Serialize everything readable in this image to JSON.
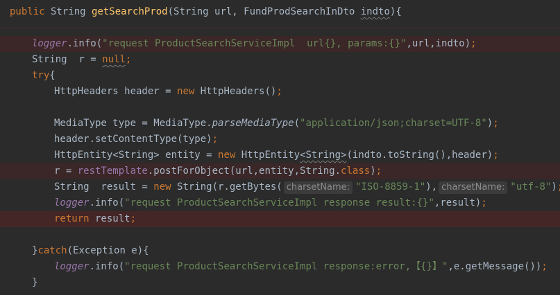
{
  "code": {
    "line1": {
      "kw_public": "public",
      "type_string": " String ",
      "method_name": "getSearchProd",
      "params_open": "(String url, FundProdSearchInDto ",
      "param_indto": "indto",
      "params_close": "){"
    },
    "line3": {
      "logger": "logger",
      "call": ".info(",
      "str": "\"request ProductSearchServiceImpl  url{}, params:{}\"",
      "args": ",url,indto)",
      "semi": ";"
    },
    "line4": {
      "decl": "String  r = ",
      "null_kw": "null",
      "semi": ";"
    },
    "line5": {
      "try_kw": "try",
      "brace": "{"
    },
    "line6": {
      "decl": "HttpHeaders header = ",
      "new_kw": "new",
      "ctor": " HttpHeaders()",
      "semi": ";"
    },
    "line8": {
      "decl": "MediaType type = MediaType.",
      "method": "parseMediaType",
      "open": "(",
      "str": "\"application/json;charset=UTF-8\"",
      "close": ")",
      "semi": ";"
    },
    "line9": {
      "call": "header.setContentType(type)",
      "semi": ";"
    },
    "line10": {
      "decl": "HttpEntity<String> entity = ",
      "new_kw": "new",
      "ctor_a": " HttpEntity",
      "generic": "<String>",
      "ctor_b": "(indto.toString(),header)",
      "semi": ";"
    },
    "line11": {
      "assign": "r = ",
      "field": "restTemplate",
      "call": ".postForObject(url,entity,String.",
      "class_kw": "class",
      "close": ")",
      "semi": ";"
    },
    "line12": {
      "decl": "String  result = ",
      "new_kw": "new",
      "ctor": " String(r.getBytes(",
      "hint1": "charsetName:",
      "str1": "\"ISO-8859-1\"",
      "mid": "),",
      "hint2": "charsetName:",
      "str2": "\"utf-8\"",
      "close": ")",
      "semi": ";"
    },
    "line13": {
      "logger": "logger",
      "call": ".info(",
      "str": "\"request ProductSearchServiceImpl response result:{}\"",
      "args": ",result)",
      "semi": ";"
    },
    "line14": {
      "return_kw": "return",
      "value": " result",
      "semi": ";"
    },
    "line16": {
      "brace": "}",
      "catch_kw": "catch",
      "params": "(Exception e){"
    },
    "line17": {
      "logger": "logger",
      "call": ".info(",
      "str": "\"request ProductSearchServiceImpl response:error,【{}】\"",
      "args": ",e.getMessage())",
      "semi": ";"
    },
    "line18": {
      "brace": "}"
    }
  },
  "colors": {
    "background": "#2b2b2b",
    "keyword": "#cc7832",
    "method_declaration": "#ffc66d",
    "string": "#6a8759",
    "field": "#9876aa",
    "text": "#a9b7c6",
    "highlight_line": "#3b2727"
  }
}
